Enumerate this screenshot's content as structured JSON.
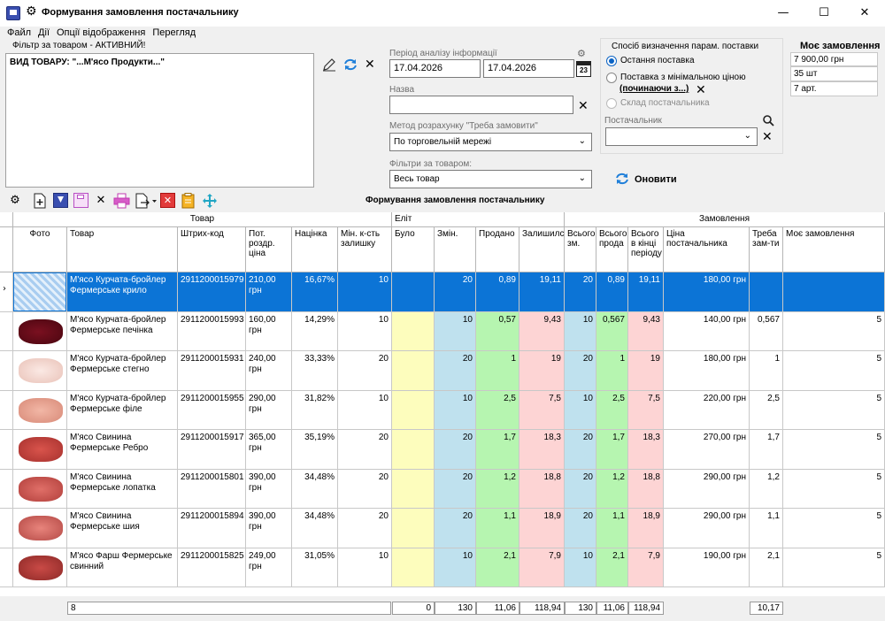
{
  "window": {
    "title": "Формування замовлення постачальнику",
    "minimize": "—",
    "maximize": "☐",
    "close": "✕"
  },
  "menu": [
    "Файл",
    "Дії",
    "Опції відображення",
    "Перегляд"
  ],
  "filter": {
    "title": "Фільтр за товаром - АКТИВНИЙ!",
    "text": "ВИД ТОВАРУ: \"...М'ясо Продукти...\""
  },
  "period": {
    "label": "Період аналізу інформації",
    "from": "17.04.2026",
    "to": "17.04.2026",
    "calendar_day": "23"
  },
  "name_field": {
    "label": "Назва",
    "value": ""
  },
  "method": {
    "label": "Метод розрахунку \"Треба замовити\"",
    "value": "По торговельній мережі"
  },
  "product_filters": {
    "label": "Фільтри за товаром:",
    "value": "Весь товар"
  },
  "params": {
    "label": "Спосіб визначення парам. поставки",
    "opt1": "Остання поставка",
    "opt2": "Поставка з мінімальною ціною",
    "opt2_link": "(починаючи з...)",
    "opt3": "Склад постачальника",
    "supplier_label": "Постачальник",
    "supplier_value": ""
  },
  "my_order": {
    "title": "Моє замовлення",
    "sum": "7 900,00 грн",
    "qty": "35 шт",
    "art": "7 арт."
  },
  "refresh_label": "Оновити",
  "grid_title": "Формування замовлення постачальнику",
  "groups": {
    "goods": "Товар",
    "left": "Еліт",
    "order": "Замовлення"
  },
  "columns": {
    "photo": "Фото",
    "name": "Товар",
    "barcode": "Штрих-код",
    "price": "Пот. роздр. ціна",
    "markup": "Націнка",
    "minstock": "Мін. к-сть залишку",
    "was": "Було",
    "changes": "Змін.",
    "sold": "Продано",
    "left": "Залишилс",
    "total_ch": "Всього зм.",
    "total_sold": "Всього прода",
    "total_end": "Всього в кінці періоду",
    "sup_price": "Ціна постачальника",
    "need": "Треба зам-ти",
    "my": "Моє замовлення"
  },
  "rows": [
    {
      "name": "М'ясо Курчата-бройлер Фермерське крило",
      "barcode": "2911200015979",
      "price": "210,00 грн",
      "markup": "16,67%",
      "minstock": "10",
      "was": "",
      "changes": "20",
      "sold": "0,89",
      "left": "19,11",
      "total_ch": "20",
      "total_sold": "0,89",
      "total_end": "19,11",
      "sup_price": "180,00 грн",
      "need": "",
      "my": ""
    },
    {
      "name": "М'ясо Курчата-бройлер Фермерське печінка",
      "barcode": "2911200015993",
      "price": "160,00 грн",
      "markup": "14,29%",
      "minstock": "10",
      "was": "",
      "changes": "10",
      "sold": "0,57",
      "left": "9,43",
      "total_ch": "10",
      "total_sold": "0,567",
      "total_end": "9,43",
      "sup_price": "140,00 грн",
      "need": "0,567",
      "my": "5"
    },
    {
      "name": "М'ясо Курчата-бройлер Фермерське стегно",
      "barcode": "2911200015931",
      "price": "240,00 грн",
      "markup": "33,33%",
      "minstock": "20",
      "was": "",
      "changes": "20",
      "sold": "1",
      "left": "19",
      "total_ch": "20",
      "total_sold": "1",
      "total_end": "19",
      "sup_price": "180,00 грн",
      "need": "1",
      "my": "5"
    },
    {
      "name": "М'ясо Курчата-бройлер Фермерське філе",
      "barcode": "2911200015955",
      "price": "290,00 грн",
      "markup": "31,82%",
      "minstock": "10",
      "was": "",
      "changes": "10",
      "sold": "2,5",
      "left": "7,5",
      "total_ch": "10",
      "total_sold": "2,5",
      "total_end": "7,5",
      "sup_price": "220,00 грн",
      "need": "2,5",
      "my": "5"
    },
    {
      "name": "М'ясо Свинина Фермерське Ребро",
      "barcode": "2911200015917",
      "price": "365,00 грн",
      "markup": "35,19%",
      "minstock": "20",
      "was": "",
      "changes": "20",
      "sold": "1,7",
      "left": "18,3",
      "total_ch": "20",
      "total_sold": "1,7",
      "total_end": "18,3",
      "sup_price": "270,00 грн",
      "need": "1,7",
      "my": "5"
    },
    {
      "name": "М'ясо Свинина Фермерське лопатка",
      "barcode": "2911200015801",
      "price": "390,00 грн",
      "markup": "34,48%",
      "minstock": "20",
      "was": "",
      "changes": "20",
      "sold": "1,2",
      "left": "18,8",
      "total_ch": "20",
      "total_sold": "1,2",
      "total_end": "18,8",
      "sup_price": "290,00 грн",
      "need": "1,2",
      "my": "5"
    },
    {
      "name": "М'ясо Свинина Фермерське шия",
      "barcode": "2911200015894",
      "price": "390,00 грн",
      "markup": "34,48%",
      "minstock": "20",
      "was": "",
      "changes": "20",
      "sold": "1,1",
      "left": "18,9",
      "total_ch": "20",
      "total_sold": "1,1",
      "total_end": "18,9",
      "sup_price": "290,00 грн",
      "need": "1,1",
      "my": "5"
    },
    {
      "name": "М'ясо Фарш Фермерське свинний",
      "barcode": "2911200015825",
      "price": "249,00 грн",
      "markup": "31,05%",
      "minstock": "10",
      "was": "",
      "changes": "10",
      "sold": "2,1",
      "left": "7,9",
      "total_ch": "10",
      "total_sold": "2,1",
      "total_end": "7,9",
      "sup_price": "190,00 грн",
      "need": "2,1",
      "my": "5"
    }
  ],
  "footer": {
    "count": "8",
    "was": "0",
    "changes": "130",
    "sold": "11,06",
    "left": "118,94",
    "total_ch": "130",
    "total_sold": "11,06",
    "total_end": "118,94",
    "need": "10,17"
  },
  "colors": {
    "selection": "#0c74d6",
    "yellow": "#fdfdbd",
    "blue": "#bfe1ee",
    "green": "#b6f5b0",
    "pink": "#fdd4d4",
    "accent": "#0b63c4"
  }
}
